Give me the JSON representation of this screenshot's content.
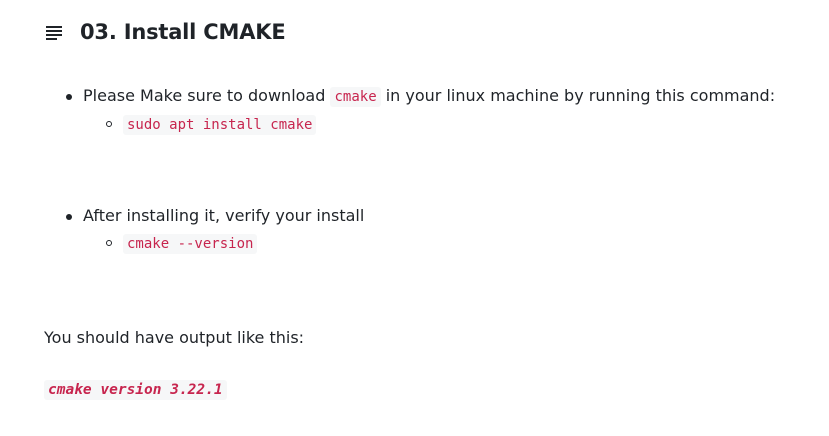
{
  "section": {
    "icon": "list-lines-icon",
    "title": "03. Install CMAKE"
  },
  "steps": [
    {
      "text_before": "Please Make sure to download ",
      "inline_code": "cmake",
      "text_after": " in your linux machine by running this command:",
      "command": "sudo apt install cmake"
    },
    {
      "text": "After installing it, verify your install",
      "command": "cmake --version"
    }
  ],
  "output_intro": "You should have output like this:",
  "output_code": "cmake version 3.22.1",
  "colors": {
    "code_text": "#c7254e",
    "code_background": "#f6f7f8",
    "body_text": "#1f2328"
  }
}
